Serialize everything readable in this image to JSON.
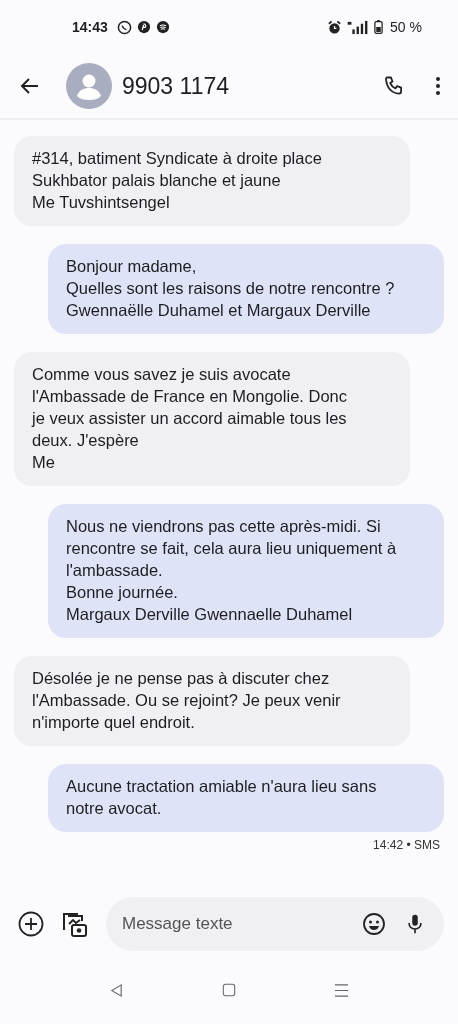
{
  "status_bar": {
    "time": "14:43",
    "battery": "50 %"
  },
  "header": {
    "title": "9903 1174"
  },
  "messages": [
    {
      "kind": "incoming",
      "text": "#314, batiment Syndicate à droite place\nSukhbator palais blanche et jaune\nMe Tuvshintsengel"
    },
    {
      "kind": "outgoing",
      "text": "Bonjour madame,\nQuelles sont les raisons de notre rencontre ?\nGwennaëlle Duhamel et Margaux Derville"
    },
    {
      "kind": "incoming",
      "text": "Comme vous savez je suis avocate\nl'Ambassade de France en Mongolie. Donc\nje veux assister un accord aimable tous les\ndeux. J'espère\nMe"
    },
    {
      "kind": "outgoing",
      "text": "Nous ne viendrons pas cette après-midi. Si\nrencontre se fait, cela aura lieu uniquement à\nl'ambassade.\nBonne journée.\nMargaux Derville Gwennaelle Duhamel"
    },
    {
      "kind": "incoming",
      "text": "Désolée je ne pense pas à discuter chez\nl'Ambassade. Ou se rejoint? Je peux venir\nn'importe quel endroit."
    },
    {
      "kind": "outgoing",
      "text": "Aucune tractation amiable n'aura lieu sans\nnotre avocat.",
      "meta": "14:42 • SMS"
    }
  ],
  "composer": {
    "placeholder": "Message texte"
  }
}
